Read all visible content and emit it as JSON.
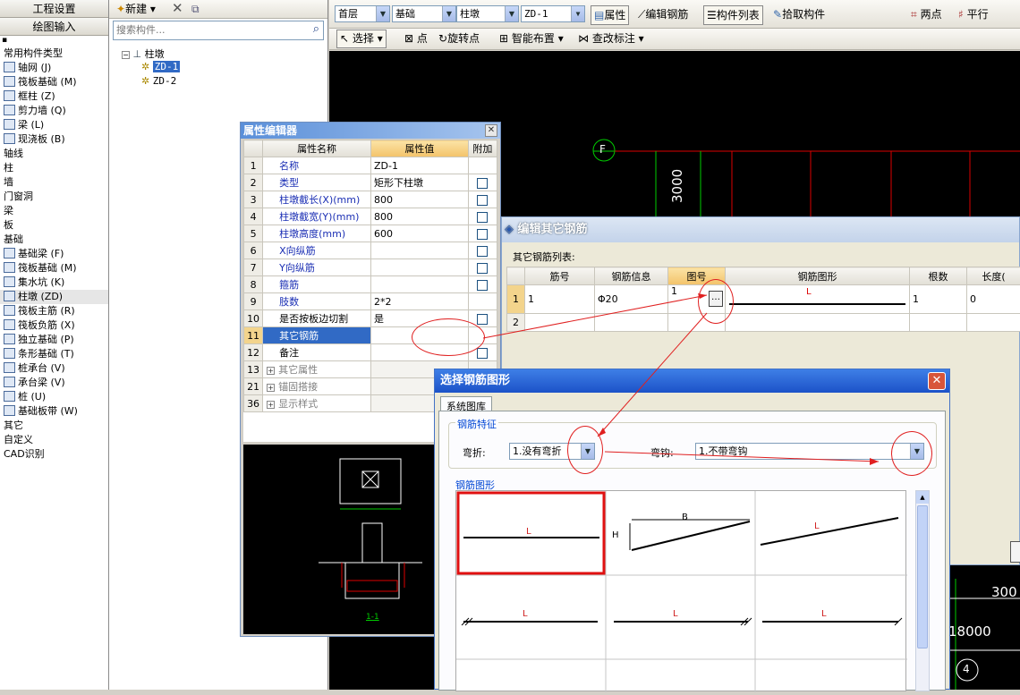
{
  "left": {
    "btn_project": "工程设置",
    "btn_draw": "绘图输入",
    "section_common": "常用构件类型",
    "items": [
      "轴网 (J)",
      "筏板基础 (M)",
      "框柱 (Z)",
      "剪力墙 (Q)",
      "梁 (L)",
      "现浇板 (B)"
    ],
    "groups": [
      "轴线",
      "柱",
      "墙",
      "门窗洞",
      "梁",
      "板",
      "基础"
    ],
    "found": [
      "基础梁 (F)",
      "筏板基础 (M)",
      "集水坑 (K)",
      "柱墩 (ZD)",
      "筏板主筋 (R)",
      "筏板负筋 (X)",
      "独立基础 (P)",
      "条形基础 (T)",
      "桩承台 (V)",
      "承台梁 (V)",
      "桩 (U)",
      "基础板带 (W)"
    ],
    "tail": [
      "其它",
      "自定义",
      "CAD识别"
    ]
  },
  "tree": {
    "new_label": "新建",
    "search_placeholder": "搜索构件...",
    "root": "柱墩",
    "children": [
      "ZD-1",
      "ZD-2"
    ]
  },
  "toolbar": {
    "floor": "首层",
    "cat": "基础",
    "type": "柱墩",
    "item": "ZD-1",
    "btn_attr": "属性",
    "btn_edit": "编辑钢筋",
    "btn_list": "构件列表",
    "btn_pick": "拾取构件",
    "btn_two": "两点",
    "btn_parallel": "平行",
    "select": "选择",
    "point": "点",
    "rotate_point": "旋转点",
    "smart": "智能布置",
    "modify": "查改标注"
  },
  "cad": {
    "axis_f": "F",
    "dim_3000": "3000",
    "dim_300": "300",
    "dim_18000": "18000",
    "axis_4": "4"
  },
  "prop": {
    "title": "属性编辑器",
    "col_name": "属性名称",
    "col_val": "属性值",
    "col_add": "附加",
    "rows": [
      {
        "n": "1",
        "name": "名称",
        "val": "ZD-1"
      },
      {
        "n": "2",
        "name": "类型",
        "val": "矩形下柱墩"
      },
      {
        "n": "3",
        "name": "柱墩截长(X)(mm)",
        "val": "800"
      },
      {
        "n": "4",
        "name": "柱墩截宽(Y)(mm)",
        "val": "800"
      },
      {
        "n": "5",
        "name": "柱墩高度(mm)",
        "val": "600"
      },
      {
        "n": "6",
        "name": "X向纵筋",
        "val": ""
      },
      {
        "n": "7",
        "name": "Y向纵筋",
        "val": ""
      },
      {
        "n": "8",
        "name": "箍筋",
        "val": ""
      },
      {
        "n": "9",
        "name": "肢数",
        "val": "2*2"
      },
      {
        "n": "10",
        "name": "是否按板边切割",
        "val": "是"
      },
      {
        "n": "11",
        "name": "其它钢筋",
        "val": ""
      },
      {
        "n": "12",
        "name": "备注",
        "val": ""
      },
      {
        "n": "13",
        "name": "其它属性",
        "val": ""
      },
      {
        "n": "21",
        "name": "锚固搭接",
        "val": ""
      },
      {
        "n": "36",
        "name": "显示样式",
        "val": ""
      }
    ],
    "drawing_label": "1-1"
  },
  "edit": {
    "title": "编辑其它钢筋",
    "list_label": "其它钢筋列表:",
    "cols": [
      "筋号",
      "钢筋信息",
      "图号",
      "钢筋图形",
      "根数",
      "长度("
    ],
    "row1": {
      "n": "1",
      "no": "1",
      "info": "Φ20",
      "fig": "1",
      "shape": "L",
      "count": "1",
      "len": "0"
    },
    "row2": {
      "n": "2"
    }
  },
  "sel": {
    "title": "选择钢筋图形",
    "tab": "系统图库",
    "feature_label": "钢筋特征",
    "bend_label": "弯折:",
    "bend_val": "1.没有弯折",
    "hook_label": "弯钩:",
    "hook_val": "1.不带弯钩",
    "shapes_label": "钢筋图形",
    "L": "L",
    "B": "B",
    "H": "H"
  }
}
